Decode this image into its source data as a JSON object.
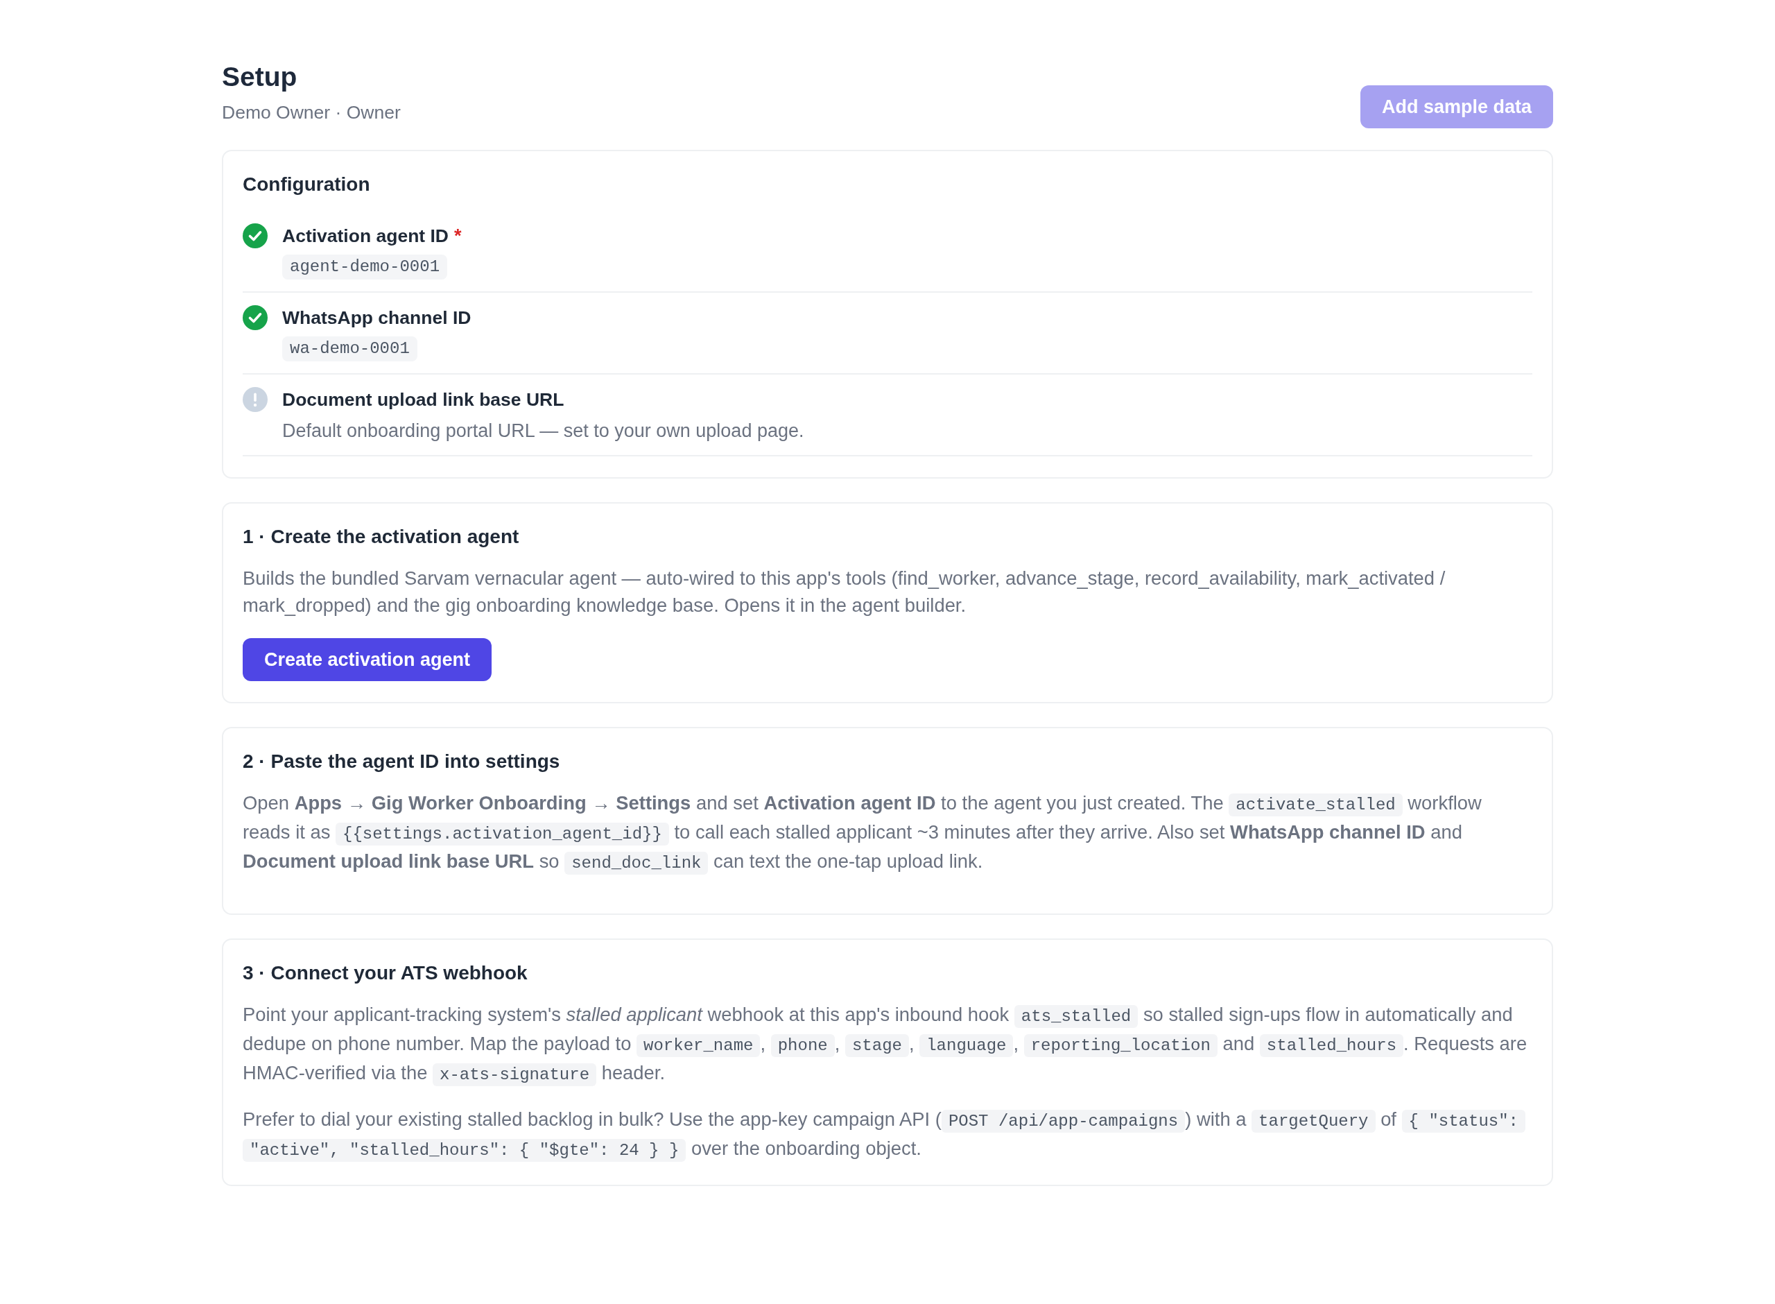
{
  "header": {
    "title": "Setup",
    "subtitle": "Demo Owner · Owner",
    "action": {
      "label": "Add sample data",
      "disabled": true
    }
  },
  "configuration": {
    "title": "Configuration",
    "items": [
      {
        "label": "Activation agent ID",
        "required_mark": "*",
        "configured": true,
        "value": "agent-demo-0001"
      },
      {
        "label": "WhatsApp channel ID",
        "configured": true,
        "value": "wa-demo-0001"
      },
      {
        "label": "Document upload link base URL",
        "configured": false,
        "description": "Default onboarding portal URL — set to your own upload page."
      }
    ]
  },
  "steps": [
    {
      "title": "1 · Create the activation agent",
      "paragraphs": [
        {
          "segments": [
            {
              "kind": "text",
              "text": "Builds the bundled Sarvam vernacular agent — auto-wired to this app's tools (find_worker, advance_stage, record_availability, mark_activated / mark_dropped) and the gig onboarding knowledge base. Opens it in the agent builder."
            }
          ]
        }
      ],
      "button": {
        "label": "Create activation agent",
        "disabled": false
      }
    },
    {
      "title": "2 · Paste the agent ID into settings",
      "paragraphs": [
        {
          "segments": [
            {
              "kind": "text",
              "text": "Open **Apps → Gig Worker Onboarding → Settings** and set **Activation agent ID** to the agent you just created. The "
            },
            {
              "kind": "code",
              "text": "activate_stalled"
            },
            {
              "kind": "text",
              "text": " workflow reads it as "
            },
            {
              "kind": "code",
              "text": "{{settings.activation_agent_id}}"
            },
            {
              "kind": "text",
              "text": " to call each stalled applicant ~3 minutes after they arrive. Also set **WhatsApp channel ID** and **Document upload link base URL** so "
            },
            {
              "kind": "code",
              "text": "send_doc_link"
            },
            {
              "kind": "text",
              "text": " can text the one-tap upload link."
            }
          ]
        }
      ]
    },
    {
      "title": "3 · Connect your ATS webhook",
      "paragraphs": [
        {
          "segments": [
            {
              "kind": "text",
              "text": "Point your applicant-tracking system's *stalled applicant* webhook at this app's inbound hook "
            },
            {
              "kind": "code",
              "text": "ats_stalled"
            },
            {
              "kind": "text",
              "text": " so stalled sign-ups flow in automatically and dedupe on phone number. Map the payload to "
            },
            {
              "kind": "code",
              "text": "worker_name"
            },
            {
              "kind": "text",
              "text": ", "
            },
            {
              "kind": "code",
              "text": "phone"
            },
            {
              "kind": "text",
              "text": ", "
            },
            {
              "kind": "code",
              "text": "stage"
            },
            {
              "kind": "text",
              "text": ", "
            },
            {
              "kind": "code",
              "text": "language"
            },
            {
              "kind": "text",
              "text": ", "
            },
            {
              "kind": "code",
              "text": "reporting_location"
            },
            {
              "kind": "text",
              "text": " and "
            },
            {
              "kind": "code",
              "text": "stalled_hours"
            },
            {
              "kind": "text",
              "text": ". Requests are HMAC-verified via the "
            },
            {
              "kind": "code",
              "text": "x-ats-signature"
            },
            {
              "kind": "text",
              "text": " header."
            }
          ]
        },
        {
          "segments": [
            {
              "kind": "text",
              "text": "Prefer to dial your existing stalled backlog in bulk? Use the app-key campaign API ("
            },
            {
              "kind": "code",
              "text": "POST /api/app-campaigns"
            },
            {
              "kind": "text",
              "text": ") with a "
            },
            {
              "kind": "code",
              "text": "targetQuery"
            },
            {
              "kind": "text",
              "text": " of "
            },
            {
              "kind": "code",
              "text": "{ \"status\": \"active\", \"stalled_hours\": { \"$gte\": 24 } }"
            },
            {
              "kind": "text",
              "text": " over the onboarding object."
            }
          ]
        }
      ]
    }
  ]
}
